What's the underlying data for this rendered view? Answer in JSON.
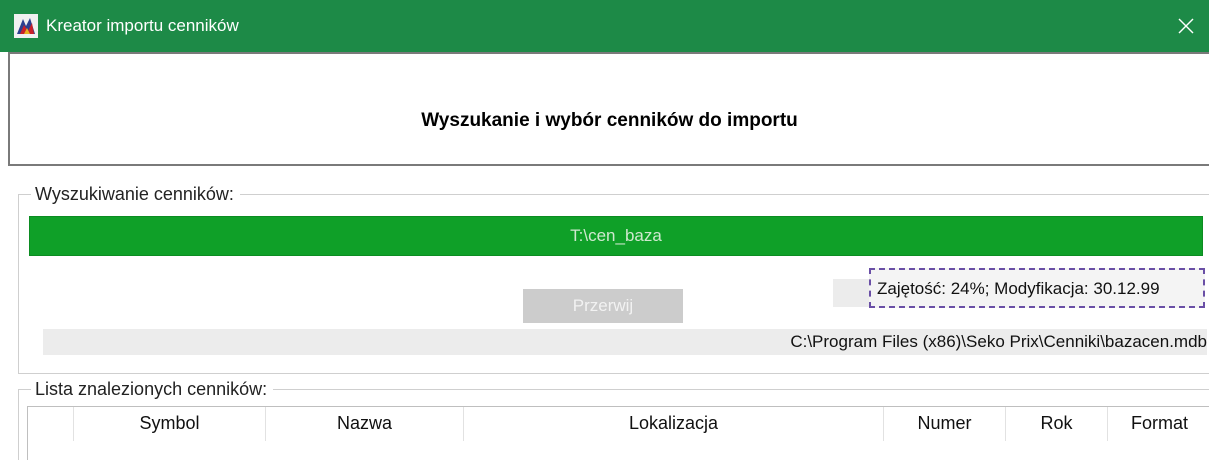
{
  "window": {
    "title": "Kreator importu cenników",
    "app_icon": "app-logo-icon",
    "close_icon": "close-icon",
    "colors": {
      "titlebar": "#1d8a47",
      "progress": "#0fa028",
      "highlight": "#6a4fa6"
    }
  },
  "header": {
    "heading": "Wyszukanie i wybór cenników do importu"
  },
  "search": {
    "legend": "Wyszukiwanie cenników:",
    "progress_text": "T:\\cen_baza",
    "stop_label": "Przerwij",
    "info_text": "Zajętość: 24%; Modyfikacja: 30.12.99",
    "path_text": "C:\\Program Files (x86)\\Seko Prix\\Cenniki\\bazacen.mdb"
  },
  "list": {
    "legend": "Lista znalezionych cenników:",
    "columns": [
      "",
      "Symbol",
      "Nazwa",
      "Lokalizacja",
      "Numer",
      "Rok",
      "Format"
    ]
  }
}
